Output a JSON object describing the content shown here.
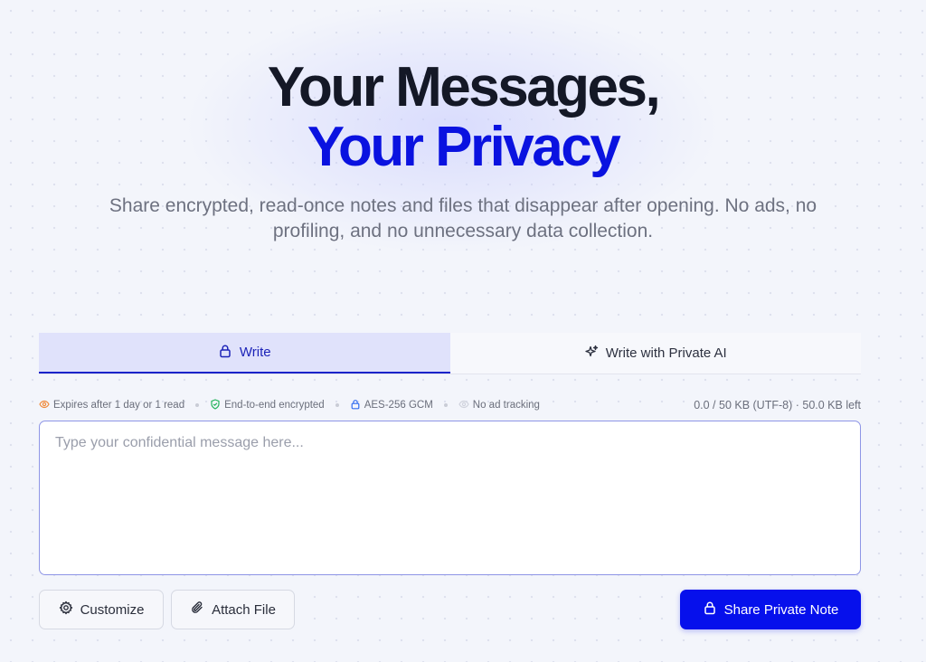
{
  "hero": {
    "title_line1": "Your Messages,",
    "title_line2": "Your Privacy",
    "subtitle": "Share encrypted, read-once notes and files that disappear after opening. No ads, no profiling, and no unnecessary data collection."
  },
  "tabs": [
    {
      "label": "Write",
      "icon": "lock-icon",
      "active": true
    },
    {
      "label": "Write with Private AI",
      "icon": "sparkle-icon",
      "active": false
    }
  ],
  "meta": {
    "items": [
      {
        "label": "Expires after 1 day or 1 read",
        "icon": "eye-icon",
        "color": "#f08a3c"
      },
      {
        "label": "End-to-end encrypted",
        "icon": "shield-icon",
        "color": "#22b35a"
      },
      {
        "label": "AES-256 GCM",
        "icon": "lock-icon",
        "color": "#2f6bf0"
      },
      {
        "label": "No ad tracking",
        "icon": "eye-off-icon",
        "color": "#d6d9e3"
      }
    ],
    "size": "0.0 / 50 KB (UTF-8) · 50.0 KB left"
  },
  "editor": {
    "placeholder": "Type your confidential message here...",
    "value": ""
  },
  "actions": {
    "customize": "Customize",
    "attach": "Attach File",
    "share": "Share Private Note"
  },
  "colors": {
    "accent": "#0610ec",
    "title_accent": "#0a12e0",
    "tab_active_bg": "#e0e2fb"
  }
}
